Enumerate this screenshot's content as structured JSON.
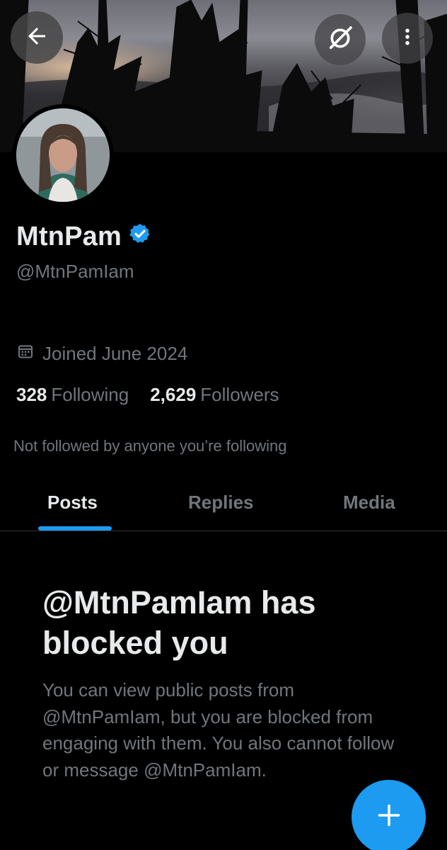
{
  "header": {
    "back_icon": "arrow-left-icon",
    "mute_icon": "notifications-off-icon",
    "more_icon": "more-vertical-icon"
  },
  "profile": {
    "display_name": "MtnPam",
    "verified_icon": "verified-badge-icon",
    "handle": "@MtnPamIam",
    "joined": "Joined June 2024",
    "following_count": "328",
    "following_label": "Following",
    "followers_count": "2,629",
    "followers_label": "Followers",
    "not_followed": "Not followed by anyone you’re following"
  },
  "tabs": [
    {
      "label": "Posts",
      "active": true
    },
    {
      "label": "Replies",
      "active": false
    },
    {
      "label": "Media",
      "active": false
    }
  ],
  "blocked_notice": {
    "title": "@MtnPamIam has blocked you",
    "body": "You can view public posts from @MtnPamIam, but you are blocked from engaging with them. You also cannot follow or message @MtnPamIam."
  },
  "fab": {
    "icon": "plus-icon"
  },
  "colors": {
    "accent": "#1d9bf0",
    "background": "#000000",
    "secondary_text": "#71767b"
  }
}
